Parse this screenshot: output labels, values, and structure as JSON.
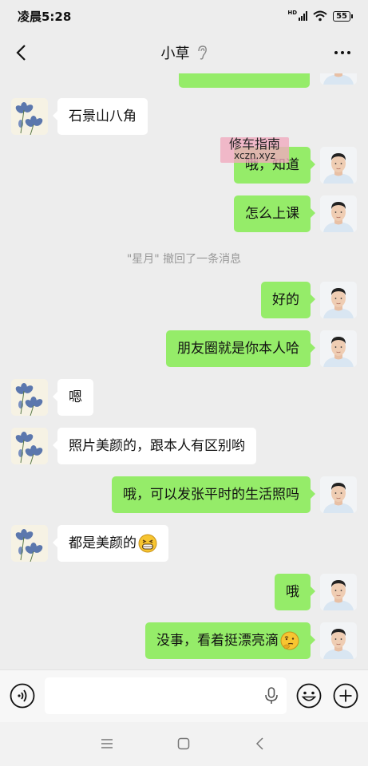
{
  "status_bar": {
    "time": "凌晨5:28",
    "network": "HD",
    "battery": "55"
  },
  "header": {
    "title": "小草"
  },
  "messages": [
    {
      "side": "in",
      "text": "石景山八角"
    },
    {
      "side": "out",
      "text": "哦，知道"
    },
    {
      "side": "out",
      "text": "怎么上课"
    },
    {
      "side": "system",
      "text": "\"星月\" 撤回了一条消息"
    },
    {
      "side": "out",
      "text": "好的"
    },
    {
      "side": "out",
      "text": "朋友圈就是你本人哈"
    },
    {
      "side": "in",
      "text": "嗯"
    },
    {
      "side": "in",
      "text": "照片美颜的，跟本人有区别哟"
    },
    {
      "side": "out",
      "text": "哦，可以发张平时的生活照吗"
    },
    {
      "side": "in",
      "text": "都是美颜的",
      "emoji": "grin-emoji"
    },
    {
      "side": "out",
      "text": "哦"
    },
    {
      "side": "out",
      "text": "没事，看着挺漂亮滴",
      "emoji": "thinking-emoji"
    }
  ],
  "watermark": {
    "line1": "修车指南",
    "line2": "xczn.xyz"
  },
  "icons": {
    "back": "back-chevron-icon",
    "ear": "ear-icon",
    "more": "more-dots-icon",
    "voice": "voice-icon",
    "mic": "mic-icon",
    "emoji": "emoji-icon",
    "plus": "plus-icon",
    "nav_menu": "menu-icon",
    "nav_home": "home-icon",
    "nav_back": "nav-back-icon"
  },
  "colors": {
    "background": "#ededed",
    "sent_bubble": "#95ec69",
    "received_bubble": "#ffffff"
  }
}
